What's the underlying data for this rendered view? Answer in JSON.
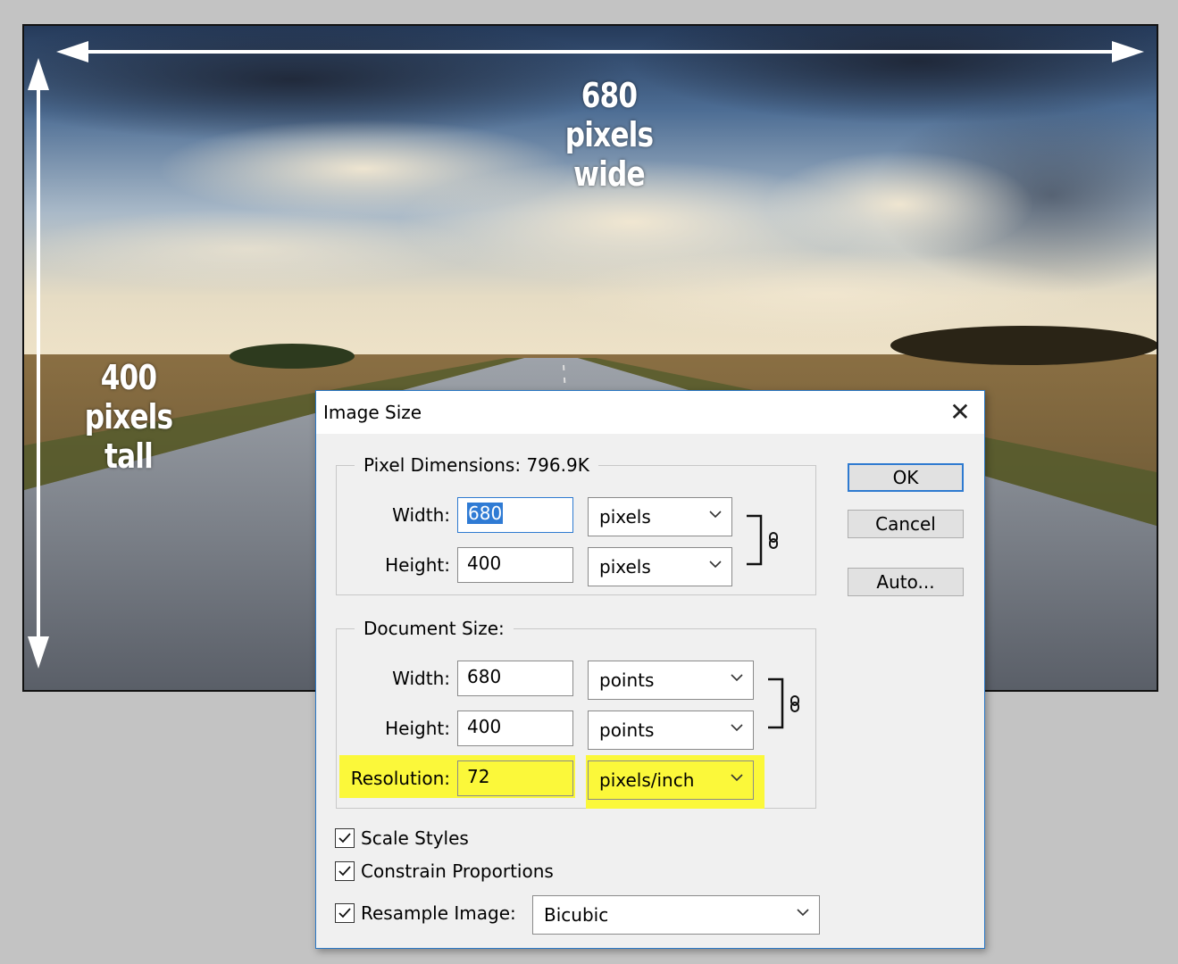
{
  "photo": {
    "annotation_width": [
      "680 pixels",
      "wide"
    ],
    "annotation_height": [
      "400 pixels",
      "tall"
    ]
  },
  "dialog": {
    "title": "Image Size",
    "close_icon": "close-icon",
    "pixel_dimensions": {
      "legend": "Pixel Dimensions:  796.9K",
      "width_label": "Width:",
      "width_value": "680",
      "width_unit": "pixels",
      "height_label": "Height:",
      "height_value": "400",
      "height_unit": "pixels"
    },
    "document_size": {
      "legend": "Document Size:",
      "width_label": "Width:",
      "width_value": "680",
      "width_unit": "points",
      "height_label": "Height:",
      "height_value": "400",
      "height_unit": "points",
      "resolution_label": "Resolution:",
      "resolution_value": "72",
      "resolution_unit": "pixels/inch"
    },
    "buttons": {
      "ok": "OK",
      "cancel": "Cancel",
      "auto": "Auto..."
    },
    "options": {
      "scale_styles": "Scale Styles",
      "constrain": "Constrain Proportions",
      "resample_label": "Resample Image:",
      "resample_value": "Bicubic",
      "scale_styles_checked": true,
      "constrain_checked": true,
      "resample_checked": true
    },
    "highlight_color": "#fbf83a",
    "accent_color": "#2e7ad0"
  }
}
